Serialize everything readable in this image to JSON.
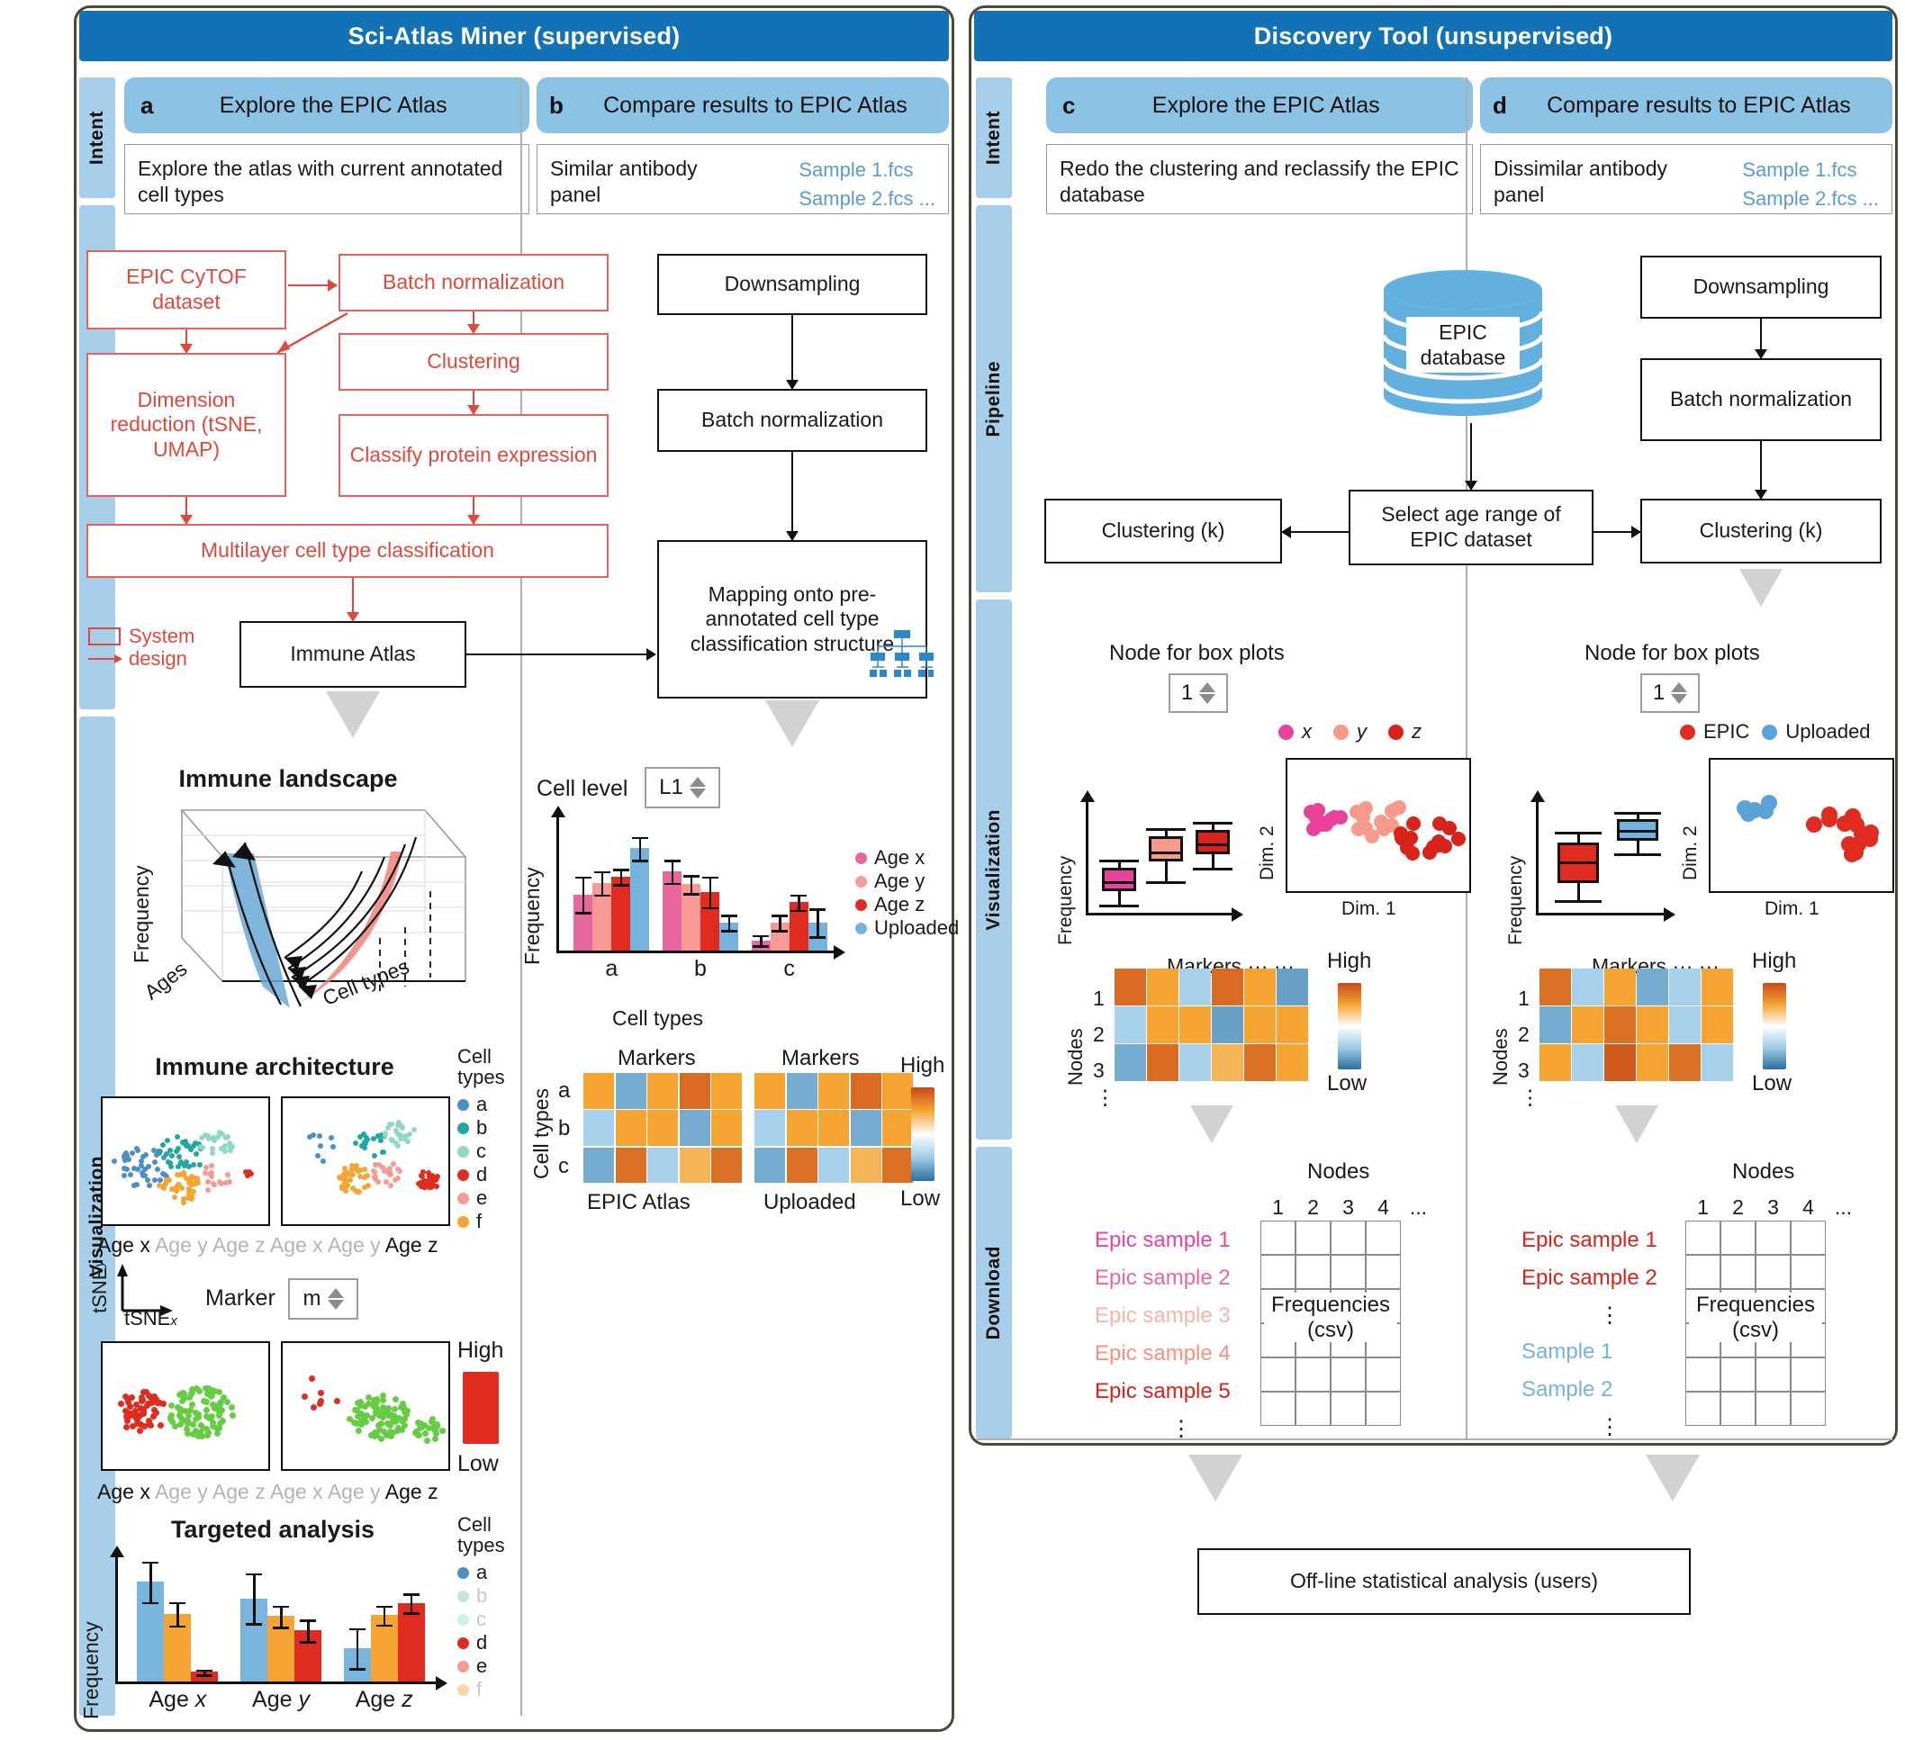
{
  "left_panel": {
    "title": "Sci-Atlas Miner (supervised)",
    "stages": {
      "intent": "Intent",
      "pipeline": "Pipeline",
      "visualization": "Visualization"
    },
    "intents": [
      {
        "letter": "a",
        "title": "Explore the EPIC Atlas",
        "desc": "Explore the atlas with current annotated cell types",
        "files": []
      },
      {
        "letter": "b",
        "title": "Compare results to EPIC Atlas",
        "desc": "Similar antibody panel",
        "files": [
          "Sample 1.fcs",
          "Sample 2.fcs ..."
        ]
      }
    ],
    "pipeline_a": {
      "nodes": [
        "EPIC CyTOF dataset",
        "Batch normalization",
        "Clustering",
        "Dimension reduction (tSNE, UMAP)",
        "Classify protein expression",
        "Multilayer cell type classification",
        "Immune Atlas"
      ],
      "legend": {
        "box_label": "System",
        "arrow_label": "design"
      }
    },
    "pipeline_b": {
      "nodes": [
        "Downsampling",
        "Batch normalization",
        "Mapping onto pre-annotated cell type classification structure"
      ]
    },
    "viz_a": {
      "landscape_title": "Immune landscape",
      "landscape_axes": {
        "y": "Frequency",
        "x1": "Ages",
        "x2": "Cell types"
      },
      "architecture_title": "Immune architecture",
      "celltypes_header": "Cell types",
      "celltypes": [
        {
          "label": "a",
          "color": "#4a8fc8"
        },
        {
          "label": "b",
          "color": "#1fa7a0"
        },
        {
          "label": "c",
          "color": "#8ed8c4"
        },
        {
          "label": "d",
          "color": "#e02b20"
        },
        {
          "label": "e",
          "color": "#f59b92"
        },
        {
          "label": "f",
          "color": "#f5a431"
        }
      ],
      "age_strip": [
        "Age x",
        "Age y",
        "Age z",
        "Age x",
        "Age y",
        "Age z"
      ],
      "age_strip_active": [
        0,
        5
      ],
      "tsne_axes": {
        "y": "tSNE",
        "y_sub": "y",
        "x": "tSNE",
        "x_sub": "x"
      },
      "marker_label": "Marker",
      "marker_value": "m",
      "scale_high": "High",
      "scale_low": "Low",
      "targeted_title": "Targeted analysis",
      "targeted_ylabel": "Frequency"
    },
    "viz_b": {
      "cell_level_label": "Cell level",
      "cell_level_value": "L1",
      "bar_ylabel": "Frequency",
      "bar_xlabel": "Cell types",
      "legend": [
        {
          "label": "Age x",
          "color": "#e8679f"
        },
        {
          "label": "Age y",
          "color": "#f79a95"
        },
        {
          "label": "Age z",
          "color": "#e02b20"
        },
        {
          "label": "Uploaded",
          "color": "#74b3dd"
        }
      ],
      "heatmap_row_axis": "Cell types",
      "heatmap_rows": [
        "a",
        "b",
        "c"
      ],
      "heatmap_col_title": "Markers",
      "heatmap_left_caption": "EPIC Atlas",
      "heatmap_right_caption": "Uploaded",
      "scale_high": "High",
      "scale_low": "Low"
    }
  },
  "right_panel": {
    "title": "Discovery Tool (unsupervised)",
    "stages": {
      "intent": "Intent",
      "pipeline": "Pipeline",
      "visualization": "Visualization",
      "download": "Download"
    },
    "intents": [
      {
        "letter": "c",
        "title": "Explore the EPIC Atlas",
        "desc": "Redo the clustering and reclassify the EPIC database",
        "files": []
      },
      {
        "letter": "d",
        "title": "Compare results to EPIC Atlas",
        "desc": "Dissimilar antibody panel",
        "files": [
          "Sample 1.fcs",
          "Sample 2.fcs ..."
        ]
      }
    ],
    "pipeline": {
      "database": "EPIC database",
      "select_node": "Select age range of EPIC dataset",
      "clustering_left": "Clustering (k)",
      "clustering_right": "Clustering (k)",
      "downsampling": "Downsampling",
      "batch_norm": "Batch normalization"
    },
    "viz_c": {
      "node_label": "Node for box plots",
      "node_value": "1",
      "box_ylabel": "Frequency",
      "scatter_xlabel": "Dim. 1",
      "scatter_ylabel": "Dim. 2",
      "legend": [
        {
          "label": "x",
          "color": "#e8429a"
        },
        {
          "label": "y",
          "color": "#f79a8c"
        },
        {
          "label": "z",
          "color": "#d8221a"
        }
      ],
      "heatmap_row_axis": "Nodes",
      "heatmap_rows": [
        "1",
        "2",
        "3"
      ],
      "heatmap_col_title": "Markers ··· ···",
      "scale_high": "High",
      "scale_low": "Low"
    },
    "viz_d": {
      "node_label": "Node for box plots",
      "node_value": "1",
      "box_ylabel": "Frequency",
      "scatter_xlabel": "Dim. 1",
      "scatter_ylabel": "Dim. 2",
      "legend": [
        {
          "label": "EPIC",
          "color": "#e02b20"
        },
        {
          "label": "Uploaded",
          "color": "#5ba3d6"
        }
      ],
      "heatmap_row_axis": "Nodes",
      "heatmap_rows": [
        "1",
        "2",
        "3"
      ],
      "heatmap_col_title": "Markers ··· ···",
      "scale_high": "High",
      "scale_low": "Low"
    },
    "download_c": {
      "nodes_title": "Nodes",
      "col_headers": [
        "1",
        "2",
        "3",
        "4",
        "..."
      ],
      "table_caption": "Frequencies (csv)",
      "samples": [
        {
          "label": "Epic sample 1",
          "color": "#e8429a"
        },
        {
          "label": "Epic sample 2",
          "color": "#e8679f"
        },
        {
          "label": "Epic sample 3",
          "color": "#f6b3a8"
        },
        {
          "label": "Epic sample 4",
          "color": "#f79080"
        },
        {
          "label": "Epic sample 5",
          "color": "#d8221a"
        }
      ]
    },
    "download_d": {
      "nodes_title": "Nodes",
      "col_headers": [
        "1",
        "2",
        "3",
        "4",
        "..."
      ],
      "table_caption": "Frequencies (csv)",
      "samples": [
        {
          "label": "Epic sample 1",
          "color": "#d8221a"
        },
        {
          "label": "Epic sample 2",
          "color": "#d8221a"
        },
        {
          "label": "Sample 1",
          "color": "#74b3dd"
        },
        {
          "label": "Sample 2",
          "color": "#74b3dd"
        }
      ]
    },
    "footer_box": "Off-line statistical analysis (users)"
  },
  "chart_data": [
    {
      "type": "bar",
      "id": "panel-b-frequency-bars",
      "title": "",
      "xlabel": "Cell types",
      "ylabel": "Frequency",
      "categories": [
        "a",
        "b",
        "c"
      ],
      "series": [
        {
          "name": "Age x",
          "color": "#e8679f",
          "values": [
            44,
            62,
            8
          ],
          "errors": [
            14,
            9,
            4
          ]
        },
        {
          "name": "Age y",
          "color": "#f79a95",
          "values": [
            53,
            52,
            22
          ],
          "errors": [
            9,
            7,
            6
          ]
        },
        {
          "name": "Age z",
          "color": "#e02b20",
          "values": [
            58,
            46,
            38
          ],
          "errors": [
            6,
            12,
            6
          ]
        },
        {
          "name": "Uploaded",
          "color": "#74b3dd",
          "values": [
            80,
            22,
            22
          ],
          "errors": [
            9,
            6,
            11
          ]
        }
      ],
      "ylim": [
        0,
        100
      ],
      "grid": false,
      "legend_position": "right"
    },
    {
      "type": "bar",
      "id": "targeted-analysis-bars",
      "title": "Targeted analysis",
      "xlabel": "",
      "ylabel": "Frequency",
      "categories": [
        "Age x",
        "Age y",
        "Age z"
      ],
      "series": [
        {
          "name": "a",
          "color": "#79b4dd",
          "values": [
            84,
            70,
            28
          ],
          "errors": [
            17,
            21,
            17
          ]
        },
        {
          "name": "d",
          "color": "#e02b20",
          "values": [
            8,
            43,
            66
          ],
          "errors": [
            2,
            9,
            8
          ]
        },
        {
          "name": "f",
          "color": "#f5a431",
          "values": [
            57,
            55,
            56
          ],
          "errors": [
            10,
            9,
            8
          ]
        }
      ],
      "series_order": [
        "a",
        "f",
        "d"
      ],
      "ylim": [
        0,
        100
      ],
      "grid": false,
      "legend_position": "right"
    },
    {
      "type": "heatmap",
      "id": "panel-b-heatmap-epic",
      "title": "EPIC Atlas",
      "xlabel": "Markers",
      "ylabel": "Cell types",
      "rows": [
        "a",
        "b",
        "c"
      ],
      "cols": [
        "m1",
        "m2",
        "m3",
        "m4",
        "m5"
      ],
      "values": [
        [
          0.72,
          0.18,
          0.72,
          0.9,
          0.72
        ],
        [
          0.3,
          0.72,
          0.72,
          0.18,
          0.72
        ],
        [
          0.18,
          0.88,
          0.3,
          0.68,
          0.88
        ]
      ],
      "colorscale": [
        "#3c7fb1",
        "#9ecde8",
        "#ffffff",
        "#f5a431",
        "#c84a1a"
      ],
      "scale_high": "High",
      "scale_low": "Low"
    },
    {
      "type": "heatmap",
      "id": "panel-b-heatmap-uploaded",
      "title": "Uploaded",
      "xlabel": "Markers",
      "ylabel": "Cell types",
      "rows": [
        "a",
        "b",
        "c"
      ],
      "cols": [
        "m1",
        "m2",
        "m3",
        "m4",
        "m5"
      ],
      "values": [
        [
          0.72,
          0.18,
          0.72,
          0.9,
          0.72
        ],
        [
          0.3,
          0.72,
          0.72,
          0.18,
          0.72
        ],
        [
          0.18,
          0.88,
          0.3,
          0.68,
          0.88
        ]
      ],
      "colorscale": [
        "#3c7fb1",
        "#9ecde8",
        "#ffffff",
        "#f5a431",
        "#c84a1a"
      ],
      "scale_high": "High",
      "scale_low": "Low"
    },
    {
      "type": "box",
      "id": "panel-c-boxplots",
      "ylabel": "Frequency",
      "categories": [
        "x",
        "y",
        "z"
      ],
      "colors": [
        "#e8429a",
        "#f79a8c",
        "#d8221a"
      ],
      "boxes": [
        {
          "min": 8,
          "q1": 20,
          "median": 30,
          "q3": 42,
          "max": 50
        },
        {
          "min": 30,
          "q1": 48,
          "median": 58,
          "q3": 72,
          "max": 80
        },
        {
          "min": 42,
          "q1": 55,
          "median": 65,
          "q3": 78,
          "max": 86
        }
      ]
    },
    {
      "type": "box",
      "id": "panel-d-boxplots",
      "ylabel": "Frequency",
      "categories": [
        "EPIC",
        "Uploaded"
      ],
      "colors": [
        "#e02b20",
        "#74b3dd"
      ],
      "boxes": [
        {
          "min": 12,
          "q1": 28,
          "median": 48,
          "q3": 66,
          "max": 76
        },
        {
          "min": 56,
          "q1": 68,
          "median": 78,
          "q3": 88,
          "max": 95
        }
      ]
    },
    {
      "type": "scatter",
      "id": "panel-c-scatter",
      "xlabel": "Dim. 1",
      "ylabel": "Dim. 2",
      "series": [
        {
          "name": "x",
          "color": "#e8429a",
          "n": 10
        },
        {
          "name": "y",
          "color": "#f79a8c",
          "n": 12
        },
        {
          "name": "z",
          "color": "#d8221a",
          "n": 15
        }
      ]
    },
    {
      "type": "scatter",
      "id": "panel-d-scatter",
      "xlabel": "Dim. 1",
      "ylabel": "Dim. 2",
      "series": [
        {
          "name": "Uploaded",
          "color": "#5ba3d6",
          "n": 5
        },
        {
          "name": "EPIC",
          "color": "#e02b20",
          "n": 14
        }
      ]
    },
    {
      "type": "heatmap",
      "id": "panel-c-node-heatmap",
      "ylabel": "Nodes",
      "xlabel": "Markers",
      "rows": [
        "1",
        "2",
        "3"
      ],
      "cols": [
        "m1",
        "m2",
        "m3",
        "m4",
        "m5",
        "m6"
      ],
      "values": [
        [
          0.9,
          0.72,
          0.3,
          0.9,
          0.72,
          0.15
        ],
        [
          0.3,
          0.72,
          0.72,
          0.15,
          0.72,
          0.72
        ],
        [
          0.18,
          0.9,
          0.3,
          0.68,
          0.88,
          0.72
        ]
      ],
      "scale_high": "High",
      "scale_low": "Low"
    },
    {
      "type": "heatmap",
      "id": "panel-d-node-heatmap",
      "ylabel": "Nodes",
      "xlabel": "Markers",
      "rows": [
        "1",
        "2",
        "3"
      ],
      "cols": [
        "m1",
        "m2",
        "m3",
        "m4",
        "m5",
        "m6"
      ],
      "values": [
        [
          0.88,
          0.3,
          0.72,
          0.18,
          0.3,
          0.72
        ],
        [
          0.18,
          0.72,
          0.88,
          0.72,
          0.3,
          0.72
        ],
        [
          0.72,
          0.3,
          0.95,
          0.72,
          0.88,
          0.3
        ]
      ],
      "scale_high": "High",
      "scale_low": "Low"
    },
    {
      "type": "scatter",
      "id": "immune-architecture-tsne",
      "xlabel": "tSNE x",
      "ylabel": "tSNE y",
      "series": [
        {
          "name": "a",
          "color": "#4a8fc8"
        },
        {
          "name": "b",
          "color": "#1fa7a0"
        },
        {
          "name": "c",
          "color": "#8ed8c4"
        },
        {
          "name": "d",
          "color": "#e02b20"
        },
        {
          "name": "e",
          "color": "#f59b92"
        },
        {
          "name": "f",
          "color": "#f5a431"
        }
      ]
    },
    {
      "type": "scatter",
      "id": "marker-expression-tsne",
      "xlabel": "tSNE x",
      "ylabel": "tSNE y",
      "series": [
        {
          "name": "high",
          "color": "#e02b20"
        },
        {
          "name": "low",
          "color": "#66cc44"
        }
      ],
      "scale_high": "High",
      "scale_low": "Low"
    }
  ]
}
